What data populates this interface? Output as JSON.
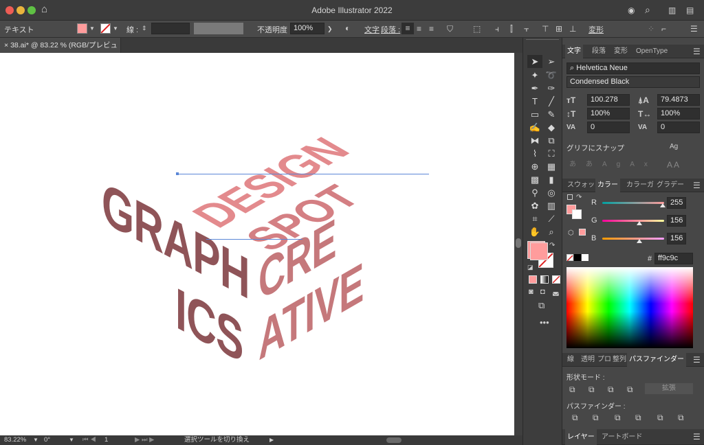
{
  "window": {
    "title": "Adobe Illustrator 2022"
  },
  "control_bar": {
    "type_label": "テキスト",
    "stroke_label": "線 :",
    "opacity_label": "不透明度 :",
    "opacity_value": "100%",
    "char_label": "文字",
    "para_label": "段落 :",
    "transform_label": "変形"
  },
  "document": {
    "tab_title": "38.ai* @ 83.22 % (RGB/プレビュー)"
  },
  "artwork": {
    "left_face": [
      "GRAPH",
      "ICS"
    ],
    "top_face": [
      "DESIGN",
      "SPOT"
    ],
    "right_face": [
      "CRE",
      "ATIVE"
    ]
  },
  "status_bar": {
    "zoom": "83.22%",
    "rotation": "0°",
    "artboard": "1",
    "tool_status": "選択ツールを切り換え"
  },
  "character_panel": {
    "tabs": [
      "文字",
      "段落",
      "変形",
      "OpenType"
    ],
    "font_family": "Helvetica Neue",
    "font_style": "Condensed Black",
    "font_size": "100.278",
    "leading": "79.4873",
    "vertical_scale": "100%",
    "horizontal_scale": "100%",
    "kerning": "0",
    "tracking": "0",
    "snap_label": "グリフにスナップ"
  },
  "color_panel": {
    "tabs": [
      "スウォッ",
      "カラー",
      "カラーガ",
      "グラデー"
    ],
    "r_label": "R",
    "r": "255",
    "g_label": "G",
    "g": "156",
    "b_label": "B",
    "b": "156",
    "hex_label": "#",
    "hex": "ff9c9c",
    "fill_color": "#ff9c9c"
  },
  "pathfinder_panel": {
    "tabs": [
      "線",
      "透明",
      "プロ",
      "整列",
      "パスファインダー"
    ],
    "shape_modes_label": "形状モード :",
    "expand_label": "拡張",
    "pathfinders_label": "パスファインダー :"
  },
  "layers_panel": {
    "tabs": [
      "レイヤー",
      "アートボード"
    ]
  },
  "colors": {
    "left_face": "#8f5458",
    "top_face": "#e38a8d",
    "right_face": "#c5787b",
    "guide": "#5a86d6"
  }
}
